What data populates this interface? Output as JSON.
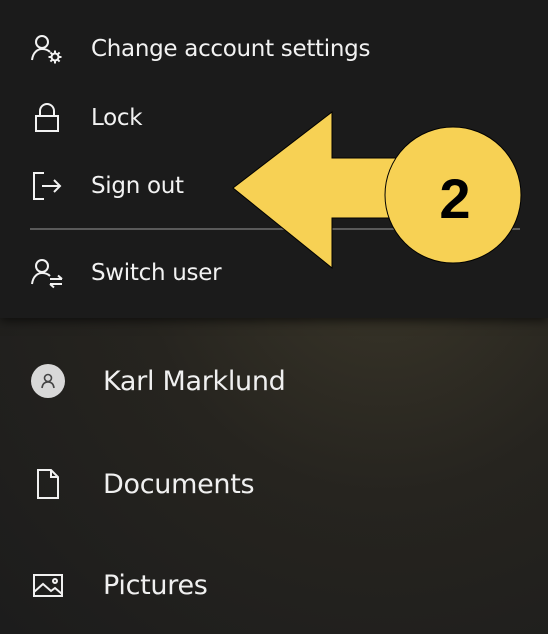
{
  "account_menu": {
    "items": [
      {
        "label": "Change account settings",
        "icon": "account-settings-icon"
      },
      {
        "label": "Lock",
        "icon": "lock-icon"
      },
      {
        "label": "Sign out",
        "icon": "sign-out-icon"
      },
      {
        "label": "Switch user",
        "icon": "switch-user-icon"
      }
    ]
  },
  "start_sidebar": {
    "items": [
      {
        "label": "Karl Marklund",
        "icon": "user-avatar-icon"
      },
      {
        "label": "Documents",
        "icon": "document-icon"
      },
      {
        "label": "Pictures",
        "icon": "pictures-icon"
      }
    ]
  },
  "annotation": {
    "step_number": "2",
    "color": "#F7D154"
  }
}
